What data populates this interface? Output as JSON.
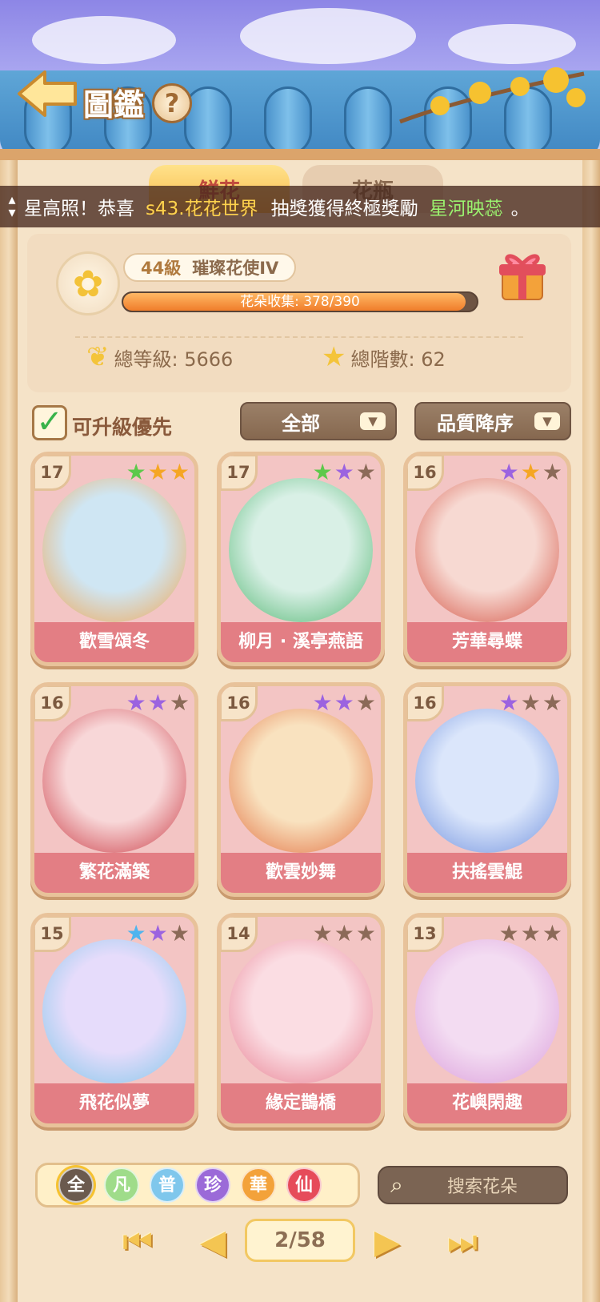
{
  "header": {
    "title": "圖鑑",
    "help_label": "?",
    "tabs": [
      {
        "label": "鮮花",
        "active": true
      },
      {
        "label": "花瓶",
        "active": false
      }
    ]
  },
  "ticker": {
    "text_start": "星高照！恭喜",
    "server_player": "s43.花花世界",
    "text_mid": "抽獎獲得終極獎勵",
    "reward": "星河映蕊",
    "text_end": "。"
  },
  "profile": {
    "level": "44級",
    "rank_title": "璀璨花使IV",
    "collection_label": "花朵收集: 378/390",
    "collection_fraction": 0.969,
    "total_level": "總等級: 5666",
    "total_stars": "總階數: 62"
  },
  "filters": {
    "upgrade_first_label": "可升級優先",
    "upgrade_first_checked": true,
    "category": "全部",
    "sort": "品質降序"
  },
  "cards": [
    {
      "level": "17",
      "name": "歡雪頌冬",
      "stars": [
        "green",
        "orange",
        "orange"
      ],
      "art": [
        "#cfe6f3",
        "#f2a24a"
      ]
    },
    {
      "level": "17",
      "name": "柳月 · 溪亭燕語",
      "stars": [
        "green",
        "purple",
        "empty"
      ],
      "art": [
        "#d9f0e6",
        "#4bb36b"
      ]
    },
    {
      "level": "16",
      "name": "芳華尋蝶",
      "stars": [
        "purple",
        "orange",
        "empty"
      ],
      "art": [
        "#f7d9d2",
        "#d24c3c"
      ]
    },
    {
      "level": "16",
      "name": "繁花滿築",
      "stars": [
        "purple",
        "purple",
        "empty"
      ],
      "art": [
        "#f8d7d8",
        "#c8323c"
      ]
    },
    {
      "level": "16",
      "name": "歡雲妙舞",
      "stars": [
        "purple",
        "purple",
        "empty"
      ],
      "art": [
        "#f9e2bf",
        "#e06a3a"
      ]
    },
    {
      "level": "16",
      "name": "扶搖雲鯤",
      "stars": [
        "purple",
        "empty",
        "empty"
      ],
      "art": [
        "#dbe6fb",
        "#6b8ddc"
      ]
    },
    {
      "level": "15",
      "name": "飛花似夢",
      "stars": [
        "blue",
        "purple",
        "empty"
      ],
      "art": [
        "#e6dcfb",
        "#7bc5e8"
      ]
    },
    {
      "level": "14",
      "name": "緣定鵲橋",
      "stars": [
        "empty",
        "empty",
        "empty"
      ],
      "art": [
        "#fbdde3",
        "#e67a8c"
      ]
    },
    {
      "level": "13",
      "name": "花嶼閑趣",
      "stars": [
        "empty",
        "empty",
        "empty"
      ],
      "art": [
        "#f3dcf2",
        "#d99ad9"
      ]
    }
  ],
  "rarity_filter": [
    {
      "label": "全",
      "color": "#6b5a4e",
      "selected": true
    },
    {
      "label": "凡",
      "color": "#9fdc8a",
      "selected": false
    },
    {
      "label": "普",
      "color": "#7fc7ec",
      "selected": false
    },
    {
      "label": "珍",
      "color": "#9b6ad8",
      "selected": false
    },
    {
      "label": "華",
      "color": "#f3a23a",
      "selected": false
    },
    {
      "label": "仙",
      "color": "#e64b5a",
      "selected": false
    }
  ],
  "search": {
    "placeholder": "搜索花朵"
  },
  "pager": {
    "current": "2/58"
  },
  "colors": {
    "star_green": "#5cc94a",
    "star_orange": "#f5a623",
    "star_purple": "#9b63e0",
    "star_blue": "#4fb4ee",
    "star_empty": "#8b6a58"
  }
}
